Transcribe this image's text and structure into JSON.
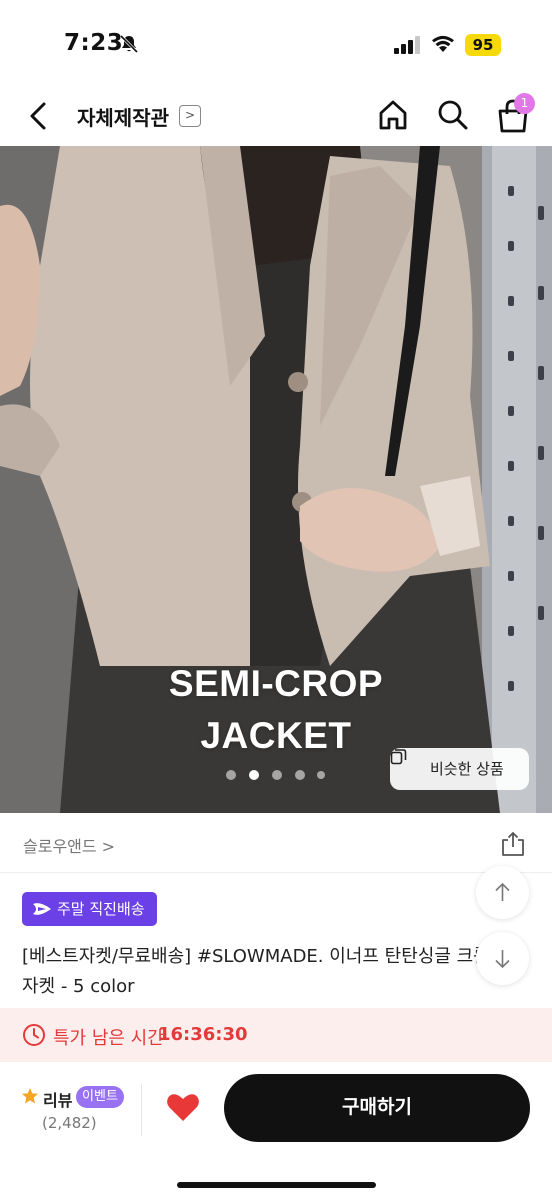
{
  "status_bar": {
    "time": "7:23",
    "battery": "95",
    "icons": [
      "bell-off-icon",
      "signal-icon",
      "wifi-icon",
      "battery-icon"
    ]
  },
  "header": {
    "store_name": "자체제작관",
    "store_chevron": ">",
    "cart_count": "1",
    "icons": [
      "back-icon",
      "home-icon",
      "search-icon",
      "cart-icon"
    ],
    "badge_color": "#e277e8"
  },
  "hero": {
    "title_line1": "SEMI-CROP",
    "title_line2": "JACKET",
    "dots_total": 5,
    "dots_active_index": 1,
    "similar_button_label": "비슷한 상품"
  },
  "brand": {
    "name": "슬로우앤드 >"
  },
  "product": {
    "delivery_badge": "주말 직진배송",
    "delivery_badge_color": "#6b40e6",
    "title": " [베스트자켓/무료배송] #SLOWMADE. 이너프 탄탄싱글 크롭자켓 - 5 color"
  },
  "timer": {
    "label": "특가 남은 시간",
    "value": "16:36:30",
    "color": "#e33a3a"
  },
  "bottom_bar": {
    "review_label": "리뷰",
    "event_badge": "이벤트",
    "review_count": "(2,482)",
    "buy_label": "구매하기",
    "heart_color": "#e93838",
    "event_color": "#9872f2"
  }
}
